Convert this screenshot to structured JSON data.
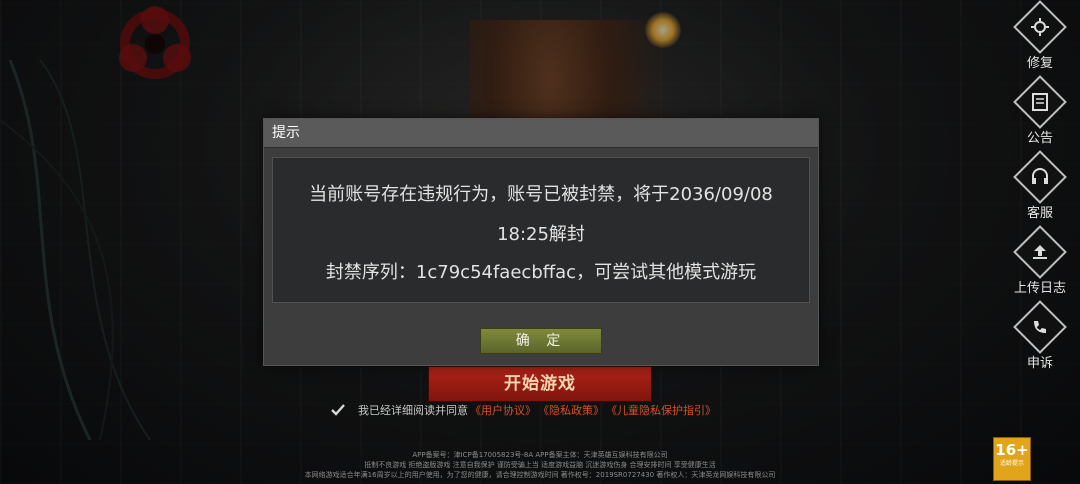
{
  "dialog": {
    "title": "提示",
    "message_line1": "当前账号存在违规行为，账号已被封禁，将于2036/09/08",
    "message_line2": "18:25解封",
    "message_line3": "封禁序列：1c79c54faecbffac，可尝试其他模式游玩",
    "ok_label": "确 定"
  },
  "side_menu": {
    "items": [
      {
        "label": "修复",
        "icon": "gear-icon"
      },
      {
        "label": "公告",
        "icon": "notice-icon"
      },
      {
        "label": "客服",
        "icon": "headset-icon"
      },
      {
        "label": "上传日志",
        "icon": "upload-icon"
      },
      {
        "label": "申诉",
        "icon": "appeal-icon"
      }
    ]
  },
  "start_button": {
    "label": "开始游戏"
  },
  "agreement": {
    "prefix": "我已经详细阅读并同意",
    "user_agreement": "《用户协议》",
    "privacy_policy": "《隐私政策》",
    "child_privacy": "《儿童隐私保护指引》"
  },
  "footer": {
    "line1": "APP备案号：津ICP备17005823号-8A   APP备案主体：天津英雄互娱科技有限公司",
    "line2": "抵制不良游戏 拒绝盗版游戏 注意自我保护 谨防受骗上当 适度游戏益脑 沉迷游戏伤身 合理安排时间 享受健康生活",
    "line3": "本网络游戏适合年满16周岁以上的用户使用，为了您的健康，请合理控制游戏时间    著作权号：2019SR0727430    著作权人：天津英龙网娱科技有限公司"
  },
  "age_rating": {
    "value": "16+",
    "caption": "适龄提示"
  },
  "colors": {
    "dialog_bg": "#3d3d3e",
    "start_red": "#b42418",
    "ok_green": "#7f8a3c",
    "link_orange": "#d9502a",
    "age_gold": "#e1a41a"
  }
}
